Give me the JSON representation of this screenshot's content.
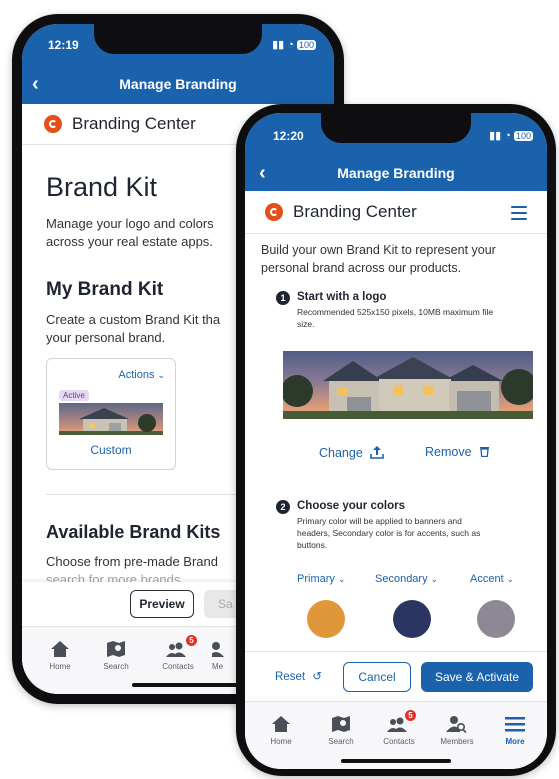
{
  "back_phone": {
    "status": {
      "time": "12:19",
      "battery": "100"
    },
    "header": {
      "title": "Manage Branding",
      "back_icon": "chevron-left-icon"
    },
    "brand_bar": {
      "title": "Branding Center"
    },
    "page": {
      "heading": "Brand Kit",
      "intro_1": "Manage your logo and colors",
      "intro_2": "across your real estate apps.",
      "my_kit_heading": "My Brand Kit",
      "my_kit_text_1": "Create a custom Brand Kit tha",
      "my_kit_text_2": "your personal brand.",
      "card": {
        "actions_label": "Actions",
        "active_badge": "Active",
        "name": "Custom"
      },
      "available_heading": "Available Brand Kits",
      "available_text_1": "Choose from pre-made Brand",
      "available_text_2": "search for more brands."
    },
    "footer": {
      "preview_label": "Preview",
      "save_label": "Sa"
    },
    "tabs": [
      {
        "label": "Home",
        "icon": "home-icon"
      },
      {
        "label": "Search",
        "icon": "map-search-icon"
      },
      {
        "label": "Contacts",
        "icon": "contacts-icon",
        "badge": "5"
      },
      {
        "label": "Me",
        "icon": "members-icon"
      }
    ]
  },
  "front_phone": {
    "status": {
      "time": "12:20",
      "battery": "100"
    },
    "header": {
      "title": "Manage Branding",
      "back_icon": "chevron-left-icon"
    },
    "brand_bar": {
      "title": "Branding Center",
      "menu_icon": "hamburger-icon"
    },
    "page": {
      "intro_1": "Build your own Brand Kit to represent your",
      "intro_2": "personal brand across our products.",
      "step1": {
        "number": "1",
        "title": "Start with a logo",
        "desc_1": "Recommended 525x150 pixels, 10MB maximum file",
        "desc_2": "size."
      },
      "change_label": "Change",
      "remove_label": "Remove",
      "step2": {
        "number": "2",
        "title": "Choose your colors",
        "desc_1": "Primary color will be applied to banners and",
        "desc_2": "headers, Secondary color is for accents, such as",
        "desc_3": "buttons."
      },
      "colors": [
        {
          "label": "Primary",
          "hex": "#e0973a"
        },
        {
          "label": "Secondary",
          "hex": "#2a3562"
        },
        {
          "label": "Accent",
          "hex": "#8e8796"
        }
      ]
    },
    "footer": {
      "reset_label": "Reset",
      "cancel_label": "Cancel",
      "save_label": "Save & Activate"
    },
    "tabs": [
      {
        "label": "Home",
        "icon": "home-icon"
      },
      {
        "label": "Search",
        "icon": "map-search-icon"
      },
      {
        "label": "Contacts",
        "icon": "contacts-icon",
        "badge": "5"
      },
      {
        "label": "Members",
        "icon": "member-search-icon"
      },
      {
        "label": "More",
        "icon": "hamburger-icon"
      }
    ]
  },
  "theme": {
    "primary_blue": "#1b62ad",
    "brand_orange": "#e4501b"
  }
}
